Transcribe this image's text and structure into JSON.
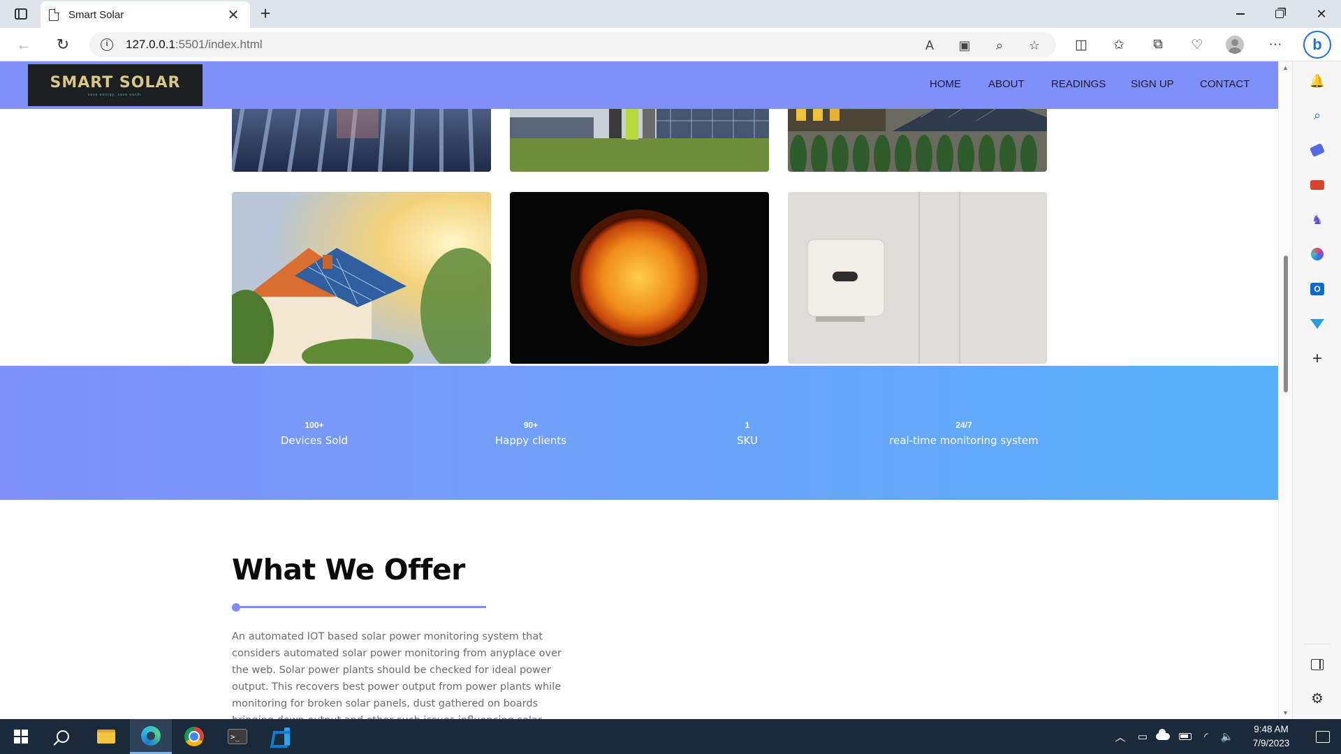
{
  "browser": {
    "tab_title": "Smart Solar",
    "tab_close": "✕",
    "new_tab": "+",
    "url_host": "127.0.0.1",
    "url_path": ":5501/index.html"
  },
  "site": {
    "logo_title": "SMART SOLAR",
    "logo_tagline": "save energy. save earth.",
    "nav": {
      "home": "HOME",
      "about": "ABOUT",
      "readings": "READINGS",
      "signup": "SIGN UP",
      "contact": "CONTACT"
    },
    "stats": [
      {
        "value": "100+",
        "label": "Devices Sold"
      },
      {
        "value": "90+",
        "label": "Happy clients"
      },
      {
        "value": "1",
        "label": "SKU"
      },
      {
        "value": "24/7",
        "label": "real-time monitoring system"
      }
    ],
    "offer": {
      "title": "What We Offer",
      "text": "An automated IOT based solar power monitoring system that considers automated solar power monitoring from anyplace over the web. Solar power plants should be checked for ideal power output. This recovers best power output from power plants while monitoring for broken solar panels, dust gathered on boards bringing down output and other such issues influencing solar"
    }
  },
  "taskbar": {
    "time": "9:48 AM",
    "date": "7/9/2023"
  },
  "colors": {
    "nav_bg": "#8090fb",
    "stats_gradient_start": "#8090fb",
    "stats_gradient_end": "#56b0f8",
    "accent_divider": "#7f8cf5",
    "taskbar_bg": "#1b2a3a"
  }
}
